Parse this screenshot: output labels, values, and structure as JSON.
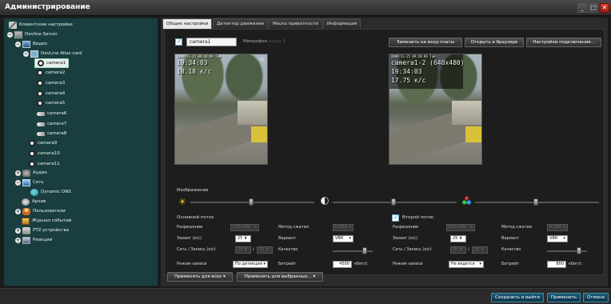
{
  "window": {
    "title": "Администрирование"
  },
  "tree": [
    {
      "label": "Клиентские настройки",
      "icon": "tools-icon"
    },
    {
      "label": "Devline Server",
      "icon": "server-icon"
    },
    {
      "label": "Видео",
      "icon": "video-icon"
    },
    {
      "label": "DevLine Atlas card",
      "icon": "capture-card-icon"
    },
    {
      "label": "camera1",
      "icon": "camera-icon",
      "selected": true
    },
    {
      "label": "camera2",
      "icon": "camera-icon"
    },
    {
      "label": "camera3",
      "icon": "camera-icon"
    },
    {
      "label": "camera4",
      "icon": "camera-icon"
    },
    {
      "label": "camera5",
      "icon": "camera-icon"
    },
    {
      "label": "camera6",
      "icon": "bullet-camera-icon"
    },
    {
      "label": "camera7",
      "icon": "bullet-camera-icon"
    },
    {
      "label": "camera8",
      "icon": "bullet-camera-icon"
    },
    {
      "label": "camera9",
      "icon": "camera-icon"
    },
    {
      "label": "camera10",
      "icon": "camera-icon"
    },
    {
      "label": "camera11",
      "icon": "camera-icon"
    },
    {
      "label": "Аудио",
      "icon": "audio-icon"
    },
    {
      "label": "Сеть",
      "icon": "network-icon"
    },
    {
      "label": "Dynamic DNS",
      "icon": "globe-icon"
    },
    {
      "label": "Архив",
      "icon": "archive-icon"
    },
    {
      "label": "Пользователи",
      "icon": "users-icon"
    },
    {
      "label": "Журнал событий",
      "icon": "journal-icon"
    },
    {
      "label": "PTZ-устройства",
      "icon": "ptz-icon"
    },
    {
      "label": "Реакции",
      "icon": "reactions-icon"
    }
  ],
  "tabs": [
    {
      "label": "Общие настройки",
      "active": true
    },
    {
      "label": "Детектор движения"
    },
    {
      "label": "Маска приватности"
    },
    {
      "label": "Информация"
    }
  ],
  "camera": {
    "name": "camera1",
    "mic_label": "Микрофон",
    "mic_value": "Audio 3",
    "buttons": {
      "replace": "Заменить на вход платы",
      "browser": "Открыть в браузере",
      "connection": "Настройки подключения..."
    }
  },
  "previews": {
    "left": {
      "stamp": "2008-11-25 09:28:09 Tue",
      "time": "19:34:03",
      "fps": "18.18 к/с"
    },
    "right": {
      "stamp": "2008-11-25 09:28:09 Tue",
      "camera": "camera1-2 (640x480)",
      "time": "19:34:03",
      "fps": "17.75 к/с"
    }
  },
  "image_section": {
    "label": "Изображение"
  },
  "main_stream": {
    "label": "Основной поток",
    "resolution_label": "Разрешение",
    "resolution_value": "720x480",
    "capture_label": "Захват (к/с)",
    "capture_value": "25",
    "network_label": "Сеть / Запись (к/с)",
    "network_value": "25",
    "record_value": "25",
    "mode_label": "Режим записи",
    "mode_value": "По детекции",
    "compression_label": "Метод сжатия",
    "compression_value": "H.264",
    "variant_label": "Вариант",
    "variant_value": "VBR",
    "quality_label": "Качество",
    "bitrate_label": "Битрейт",
    "bitrate_value": "4500",
    "bitrate_unit": "кбит/с",
    "quality_level": 0.85
  },
  "second_stream": {
    "label": "Второй поток",
    "enabled": true,
    "resolution_label": "Разрешение",
    "resolution_value": "640x480",
    "capture_label": "Захват (к/с)",
    "capture_value": "25",
    "network_label": "Сеть / Запись (к/с)",
    "network_value": "25",
    "record_value": "25",
    "mode_label": "Режим записи",
    "mode_value": "Не ведется",
    "compression_label": "Метод сжатия",
    "compression_value": "H.264",
    "variant_label": "Вариант",
    "variant_value": "VBR",
    "quality_label": "Качество",
    "bitrate_label": "Битрейт",
    "bitrate_value": "800",
    "bitrate_unit": "кбит/с",
    "quality_level": 0.85
  },
  "apply_buttons": {
    "all": "Применять для всех",
    "selected": "Применять для выбранных..."
  },
  "footer": {
    "save_exit": "Сохранить и выйти",
    "apply": "Применить",
    "cancel": "Отмена"
  },
  "colors": {
    "sidebar_bg": "#1a3e3f",
    "accent": "#2789c7",
    "footer_button": "#1a5a78",
    "close_button": "#c0281b"
  }
}
